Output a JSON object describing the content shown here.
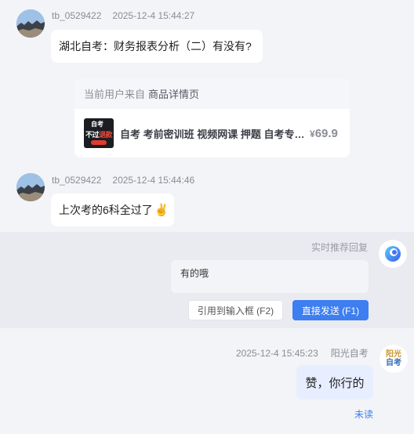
{
  "messages": [
    {
      "sender": "tb_0529422",
      "time": "2025-12-4 15:44:27",
      "text": "湖北自考：财务报表分析（二）有没有?"
    },
    {
      "sender": "tb_0529422",
      "time": "2025-12-4 15:44:46",
      "text": "上次考的6科全过了",
      "emoji": "✌️"
    }
  ],
  "product_card": {
    "source_prefix": "当前用户来自",
    "source_page": "商品详情页",
    "thumb_line1": "自考",
    "thumb_line2_a": "不过",
    "thumb_line2_b": "退款",
    "title": "自考 考前密训班 视频网课 押题 自考专…",
    "price_symbol": "¥",
    "price": "69.9"
  },
  "recommendation": {
    "label": "实时推荐回复",
    "text": "有的哦",
    "quote_button": "引用到输入框 (F2)",
    "send_button": "直接发送 (F1)"
  },
  "self_message": {
    "time": "2025-12-4 15:45:23",
    "sender": "阳光自考",
    "text": "赞，你行的",
    "status": "未读",
    "logo_line1": "阳光",
    "logo_line2": "自考"
  },
  "colors": {
    "accent": "#3d7ef0",
    "self_bubble": "#e7eeff",
    "logo_top": "#c9962e",
    "logo_bottom": "#3d6fb6"
  }
}
